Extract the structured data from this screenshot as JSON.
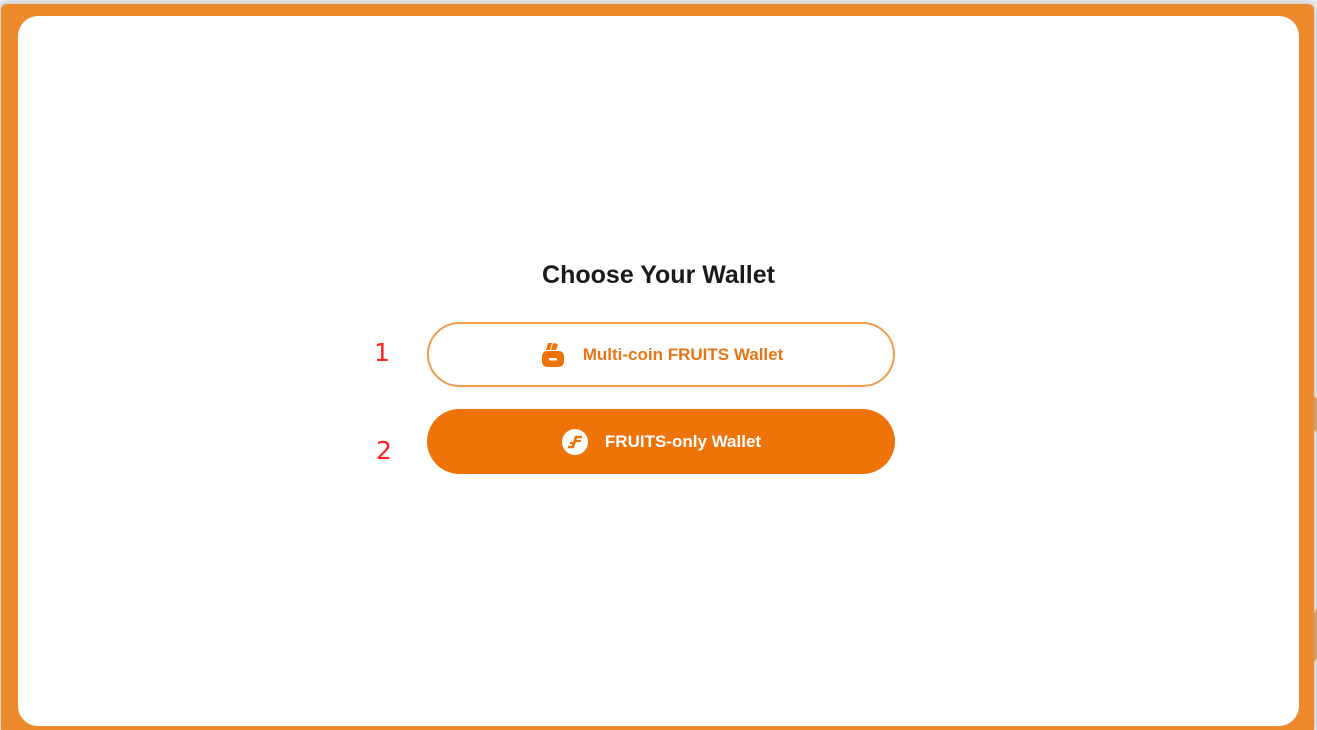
{
  "dialog": {
    "title": "Choose Your Wallet"
  },
  "options": [
    {
      "marker": "1",
      "label": "Multi-coin FRUITS Wallet",
      "icon": "wallet-icon"
    },
    {
      "marker": "2",
      "label": "FRUITS-only Wallet",
      "icon": "fruits-coin-icon"
    }
  ],
  "colors": {
    "accent": "#ee7308",
    "frame": "#ec8a2c",
    "marker": "#ff2020"
  }
}
